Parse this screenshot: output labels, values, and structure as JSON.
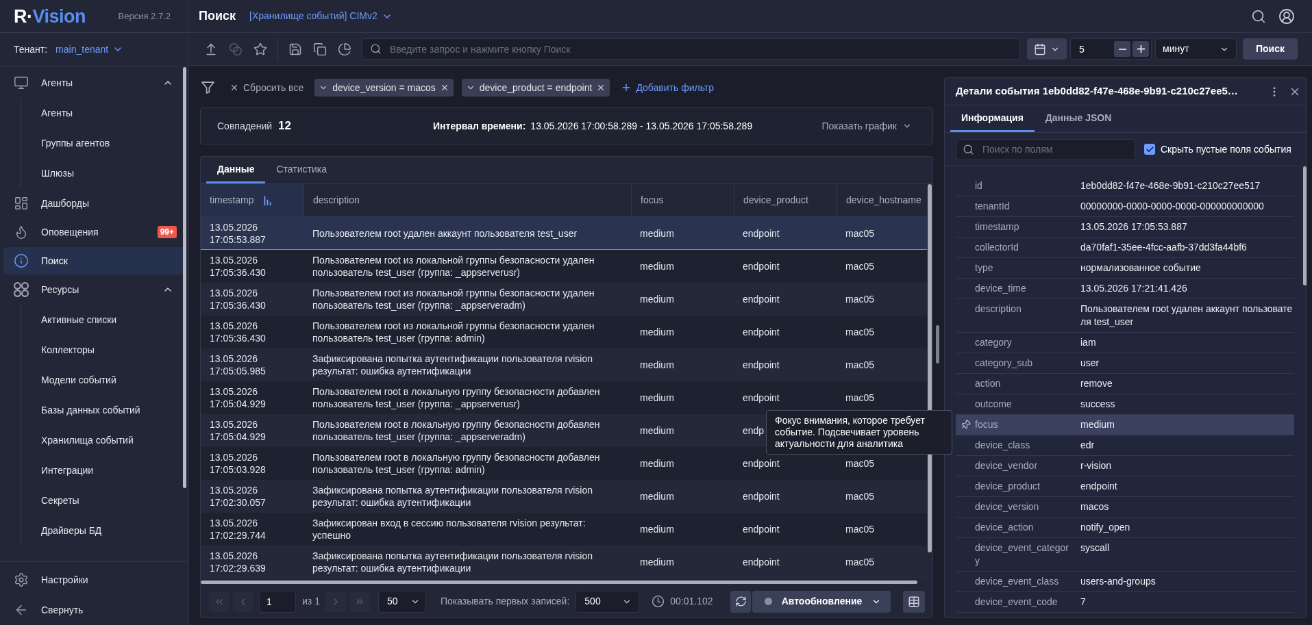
{
  "sidebar": {
    "logo": {
      "lead": "R·",
      "rest": "Vision"
    },
    "version": "Версия 2.7.2",
    "tenant": {
      "label": "Тенант:",
      "value": "main_tenant"
    },
    "nav": [
      {
        "label": "Агенты",
        "selected": false,
        "expanded": true,
        "children": [
          {
            "label": "Агенты",
            "selected": false
          },
          {
            "label": "Группы агентов",
            "selected": false
          },
          {
            "label": "Шлюзы",
            "selected": false
          }
        ]
      },
      {
        "label": "Дашборды",
        "selected": false
      },
      {
        "label": "Оповещения",
        "selected": false,
        "badge": "99+"
      },
      {
        "label": "Поиск",
        "selected": true
      },
      {
        "label": "Ресурсы",
        "selected": false,
        "expanded": true,
        "children": [
          {
            "label": "Активные списки",
            "selected": false
          },
          {
            "label": "Коллекторы",
            "selected": false
          },
          {
            "label": "Модели событий",
            "selected": false
          },
          {
            "label": "Базы данных событий",
            "selected": false
          },
          {
            "label": "Хранилища событий",
            "selected": false
          },
          {
            "label": "Интеграции",
            "selected": false
          },
          {
            "label": "Секреты",
            "selected": false
          },
          {
            "label": "Драйверы БД",
            "selected": false
          }
        ]
      }
    ],
    "footer": [
      {
        "label": "Настройки"
      },
      {
        "label": "Свернуть"
      }
    ]
  },
  "header": {
    "title": "Поиск",
    "storage": "[Хранилище событий] CIMv2"
  },
  "toolbar": {
    "buttons": [
      {
        "disabled": false
      },
      {
        "disabled": true
      },
      {
        "disabled": false
      },
      {
        "disabled": false
      },
      {
        "disabled": false
      },
      {
        "disabled": false
      }
    ],
    "search": {
      "placeholder": "Введите запрос и нажмите кнопку Поиск"
    },
    "period": {
      "value": "5",
      "unit": "минут"
    },
    "submit": "Поиск"
  },
  "filters": {
    "reset": "Сбросить все",
    "chips": [
      "device_version = macos",
      "device_product = endpoint"
    ],
    "add": "Добавить фильтр"
  },
  "summary": {
    "matches_label": "Совпадений",
    "matches": "12",
    "interval_label": "Интервал времени:",
    "interval": "13.05.2026 17:00:58.289 - 13.05.2026 17:05:58.289",
    "chart_toggle": "Показать график"
  },
  "tabs": [
    {
      "label": "Данные",
      "selected": true
    },
    {
      "label": "Статистика",
      "selected": false
    }
  ],
  "table": {
    "columns": [
      {
        "label": "timestamp",
        "sorted": true
      },
      {
        "label": "description",
        "sorted": false
      },
      {
        "label": "focus",
        "sorted": false
      },
      {
        "label": "device_product",
        "sorted": false
      },
      {
        "label": "device_hostname",
        "sorted": false
      }
    ],
    "rows": [
      {
        "selected": true,
        "date": "13.05.2026",
        "time": "17:05:53.887",
        "description": "Пользователем root удален аккаунт пользователя test_user",
        "focus": "medium",
        "product": "endpoint",
        "hostname": "mac05"
      },
      {
        "selected": false,
        "date": "13.05.2026",
        "time": "17:05:36.430",
        "description": "Пользователем root из локальной группы безопасности удален пользователь test_user (группа: _appserverusr)",
        "focus": "medium",
        "product": "endpoint",
        "hostname": "mac05"
      },
      {
        "selected": false,
        "date": "13.05.2026",
        "time": "17:05:36.430",
        "description": "Пользователем root из локальной группы безопасности удален пользователь test_user (группа: _appserveradm)",
        "focus": "medium",
        "product": "endpoint",
        "hostname": "mac05"
      },
      {
        "selected": false,
        "date": "13.05.2026",
        "time": "17:05:36.430",
        "description": "Пользователем root из локальной группы безопасности удален пользователь test_user (группа: admin)",
        "focus": "medium",
        "product": "endpoint",
        "hostname": "mac05"
      },
      {
        "selected": false,
        "date": "13.05.2026",
        "time": "17:05:05.985",
        "description": "Зафиксирована попытка аутентификации пользователя rvision результат: ошибка аутентификации",
        "focus": "medium",
        "product": "endpoint",
        "hostname": "mac05"
      },
      {
        "selected": false,
        "date": "13.05.2026",
        "time": "17:05:04.929",
        "description": "Пользователем root в локальную группу безопасности добавлен пользователь test_user (группа: _appserverusr)",
        "focus": "medium",
        "product": "endpoint",
        "hostname": "mac05"
      },
      {
        "selected": false,
        "date": "13.05.2026",
        "time": "17:05:04.929",
        "description": "Пользователем root в локальную группу безопасности добавлен пользователь test_user (группа: _appserveradm)",
        "focus": "medium",
        "product": "endp"
      },
      {
        "selected": false,
        "date": "13.05.2026",
        "time": "17:05:03.928",
        "description": "Пользователем root в локальную группу безопасности добавлен пользователь test_user (группа: admin)",
        "focus": "medium",
        "product": "endpoint",
        "hostname": "mac05"
      },
      {
        "selected": false,
        "date": "13.05.2026",
        "time": "17:02:30.057",
        "description": "Зафиксирована попытка аутентификации пользователя rvision результат: ошибка аутентификации",
        "focus": "medium",
        "product": "endpoint",
        "hostname": "mac05"
      },
      {
        "selected": false,
        "date": "13.05.2026",
        "time": "17:02:29.744",
        "description": "Зафиксирован вход в сессию пользователя rvision результат: успешно",
        "focus": "medium",
        "product": "endpoint",
        "hostname": "mac05"
      },
      {
        "selected": false,
        "date": "13.05.2026",
        "time": "17:02:29.639",
        "description": "Зафиксирована попытка аутентификации пользователя rvision результат: ошибка аутентификации",
        "focus": "medium",
        "product": "endpoint",
        "hostname": "mac05"
      }
    ]
  },
  "pager": {
    "nav_buttons": [
      {
        "disabled": true
      },
      {
        "disabled": true
      },
      {
        "disabled": true
      },
      {
        "disabled": true
      }
    ],
    "page": "1",
    "of": "из 1",
    "page_size": "50",
    "limit_label": "Показывать первых записей:",
    "limit": "500",
    "elapsed": "00:01.102",
    "autorefresh": {
      "label": "Автообновление",
      "on": false
    }
  },
  "tooltip": "Фокус внимания, которое требует событие. Подсвечивает уровень актуальности для аналитика",
  "details": {
    "title": "Детали события 1eb0dd82-f47e-468e-9b91-c210c27ee5…",
    "tabs": [
      {
        "label": "Информация",
        "selected": true
      },
      {
        "label": "Данные JSON",
        "selected": false
      }
    ],
    "search": {
      "placeholder": "Поиск по полям"
    },
    "hide_empty": {
      "label": "Скрыть пустые поля события",
      "checked": true
    },
    "fields": [
      {
        "key": "id",
        "value": "1eb0dd82-f47e-468e-9b91-c210c27ee517",
        "selected": false
      },
      {
        "key": "tenantId",
        "value": "00000000-0000-0000-0000-000000000000",
        "selected": false
      },
      {
        "key": "timestamp",
        "value": "13.05.2026 17:05:53.887",
        "selected": false
      },
      {
        "key": "collectorId",
        "value": "da70faf1-35ee-4fcc-aafb-37dd3fa44bf6",
        "selected": false
      },
      {
        "key": "type",
        "value": "нормализованное событие",
        "selected": false
      },
      {
        "key": "device_time",
        "value": "13.05.2026 17:21:41.426",
        "selected": false
      },
      {
        "key": "description",
        "value": "Пользователем root удален аккаунт пользователя test_user",
        "selected": false
      },
      {
        "key": "category",
        "value": "iam",
        "selected": false
      },
      {
        "key": "category_sub",
        "value": "user",
        "selected": false
      },
      {
        "key": "action",
        "value": "remove",
        "selected": false
      },
      {
        "key": "outcome",
        "value": "success",
        "selected": false
      },
      {
        "key": "focus",
        "value": "medium",
        "selected": true
      },
      {
        "key": "device_class",
        "value": "edr",
        "selected": false
      },
      {
        "key": "device_vendor",
        "value": "r-vision",
        "selected": false
      },
      {
        "key": "device_product",
        "value": "endpoint",
        "selected": false
      },
      {
        "key": "device_version",
        "value": "macos",
        "selected": false
      },
      {
        "key": "device_action",
        "value": "notify_open",
        "selected": false
      },
      {
        "key": "device_event_category",
        "value": "syscall",
        "selected": false
      },
      {
        "key": "device_event_class",
        "value": "users-and-groups",
        "selected": false
      },
      {
        "key": "device_event_code",
        "value": "7",
        "selected": false
      }
    ]
  }
}
